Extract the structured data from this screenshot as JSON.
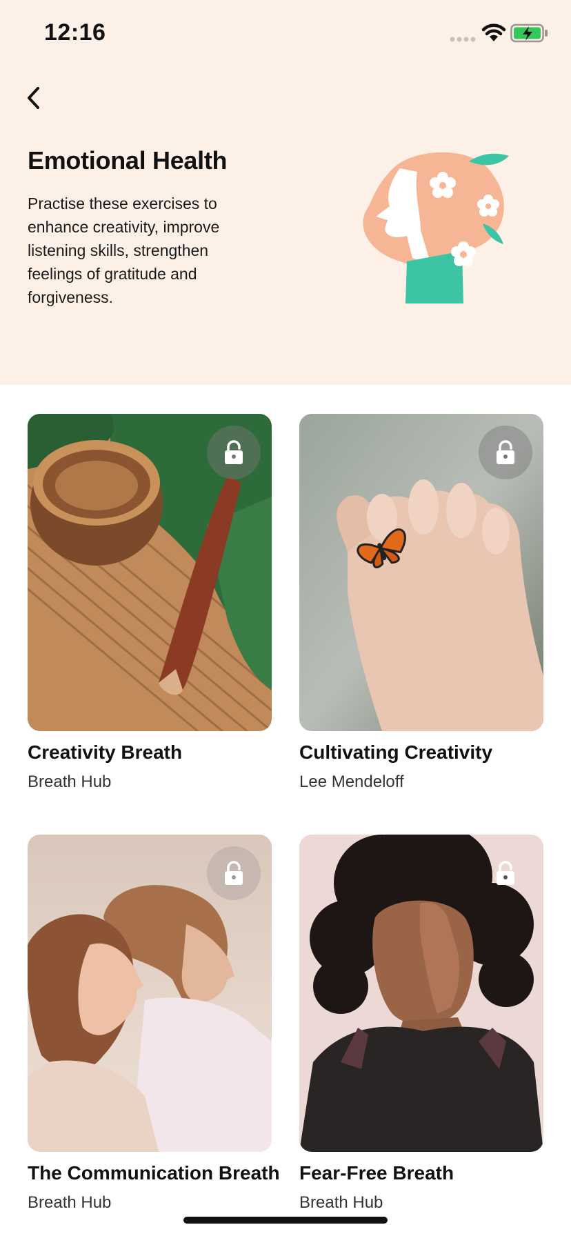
{
  "status_bar": {
    "time": "12:16"
  },
  "header": {
    "back_icon": "chevron-left-icon",
    "title": "Emotional Health",
    "description": "Practise these exercises to enhance creativity, improve listening skills, strengthen feelings of gratitude and forgiveness."
  },
  "cards": [
    {
      "title": "Creativity Breath",
      "author": "Breath Hub",
      "locked": true
    },
    {
      "title": "Cultivating Creativity",
      "author": "Lee Mendeloff",
      "locked": true
    },
    {
      "title": "The Communication Breath",
      "author": "Breath Hub",
      "locked": true
    },
    {
      "title": "Fear-Free Breath",
      "author": "Breath Hub",
      "locked": true
    }
  ],
  "colors": {
    "hero_background": "#fdf0e6",
    "illustration_peach": "#f6b695",
    "illustration_teal": "#3cc4a4",
    "battery_green": "#35c759"
  }
}
